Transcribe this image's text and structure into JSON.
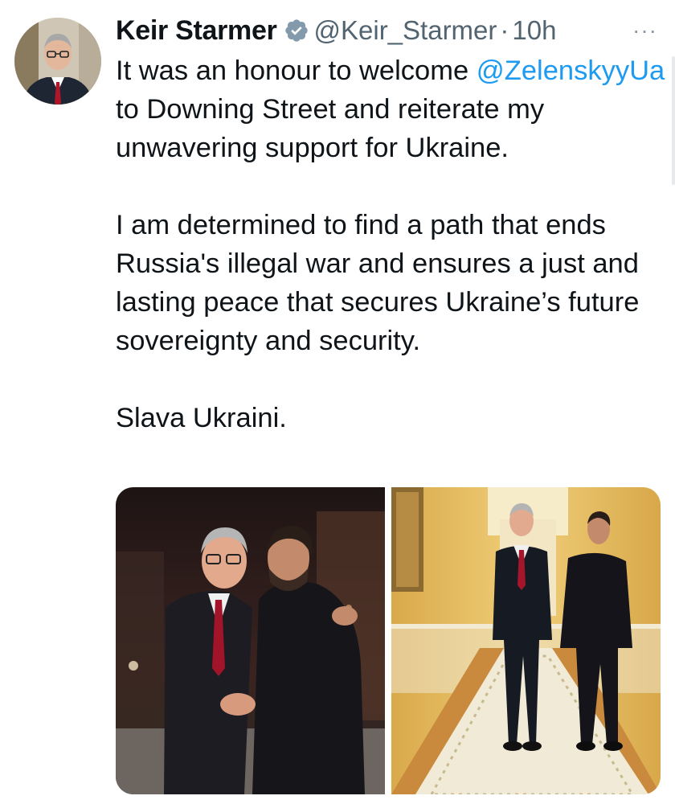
{
  "author": {
    "name": "Keir Starmer",
    "handle": "@Keir_Starmer",
    "separator": "·",
    "time": "10h",
    "verified_icon": "verified-badge-icon",
    "avatar_icon": "profile-photo"
  },
  "menu": {
    "more_label": "···"
  },
  "tweet": {
    "p1_prefix": "It was an honour to welcome ",
    "mention": "@ZelenskyyUa",
    "p1_suffix": " to Downing Street and reiterate my unwavering support for Ukraine.",
    "p2": "I am determined to find a path that ends Russia's illegal war and ensures a just and lasting peace that secures Ukraine’s future sovereignty and security.",
    "p3": "Slava Ukraini."
  },
  "media": {
    "count": 2,
    "items": [
      {
        "icon": "photo-embrace-night-street"
      },
      {
        "icon": "photo-corridor-walk"
      }
    ]
  },
  "colors": {
    "text": "#0f1419",
    "secondary": "#536471",
    "link": "#1d9bf0",
    "verified": "#829aab"
  }
}
